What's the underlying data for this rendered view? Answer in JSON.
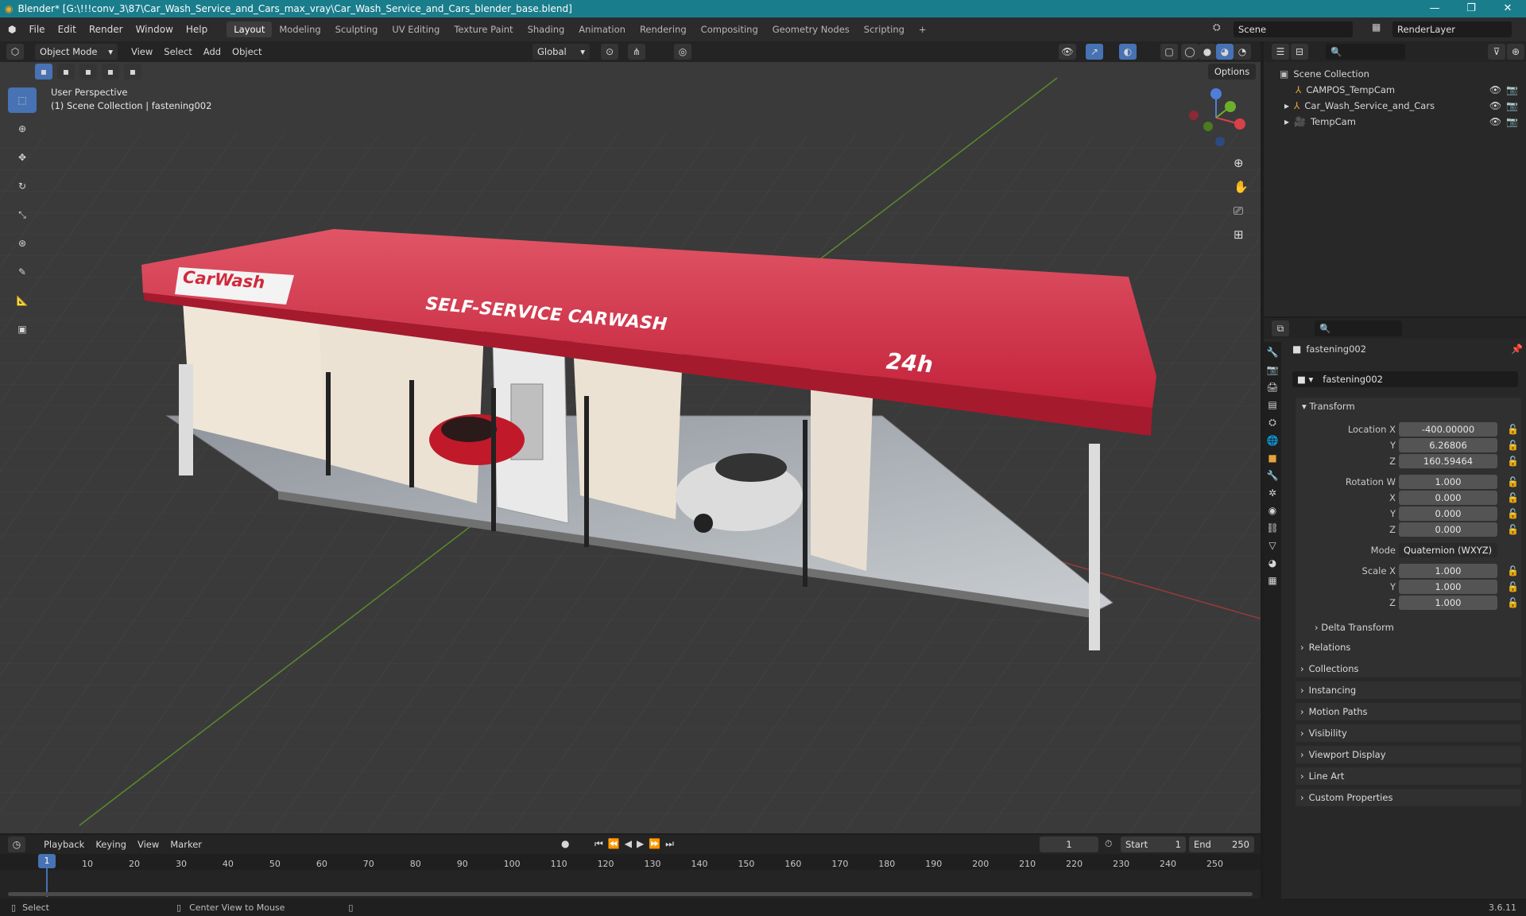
{
  "titlebar": {
    "title": "Blender* [G:\\!!!conv_3\\87\\Car_Wash_Service_and_Cars_max_vray\\Car_Wash_Service_and_Cars_blender_base.blend]"
  },
  "menu": {
    "file": "File",
    "edit": "Edit",
    "render": "Render",
    "window": "Window",
    "help": "Help"
  },
  "workspaces": [
    "Layout",
    "Modeling",
    "Sculpting",
    "UV Editing",
    "Texture Paint",
    "Shading",
    "Animation",
    "Rendering",
    "Compositing",
    "Geometry Nodes",
    "Scripting"
  ],
  "scene": {
    "name": "Scene",
    "view_layer": "RenderLayer"
  },
  "viewport_header": {
    "mode": "Object Mode",
    "view": "View",
    "select": "Select",
    "add": "Add",
    "object": "Object",
    "orientation": "Global",
    "options": "Options"
  },
  "viewport": {
    "perspective": "User Perspective",
    "context": "(1) Scene Collection | fastening002"
  },
  "scene_sign": {
    "logo": "CarWash",
    "banner": "SELF-SERVICE CARWASH",
    "hours": "24h"
  },
  "outliner": {
    "root": "Scene Collection",
    "items": [
      {
        "name": "CAMPOS_TempCam"
      },
      {
        "name": "Car_Wash_Service_and_Cars"
      },
      {
        "name": "TempCam"
      }
    ]
  },
  "properties": {
    "object_name": "fastening002",
    "data_name": "fastening002",
    "transform_header": "Transform",
    "location": {
      "label": "Location X",
      "x": "-400.00000",
      "y": "6.26806",
      "z": "160.59464"
    },
    "rotation": {
      "label": "Rotation W",
      "w": "1.000",
      "x": "0.000",
      "y": "0.000",
      "z": "0.000"
    },
    "mode": {
      "label": "Mode",
      "value": "Quaternion (WXYZ)"
    },
    "scale": {
      "label": "Scale X",
      "x": "1.000",
      "y": "1.000",
      "z": "1.000"
    },
    "axis": {
      "y": "Y",
      "z": "Z",
      "x": "X"
    },
    "delta": "Delta Transform",
    "panels": [
      "Relations",
      "Collections",
      "Instancing",
      "Motion Paths",
      "Visibility",
      "Viewport Display",
      "Line Art",
      "Custom Properties"
    ]
  },
  "timeline": {
    "playback": "Playback",
    "keying": "Keying",
    "view": "View",
    "marker": "Marker",
    "current_frame": "1",
    "start_label": "Start",
    "start": "1",
    "end_label": "End",
    "end": "250",
    "ticks": [
      "1",
      "10",
      "20",
      "30",
      "40",
      "50",
      "60",
      "70",
      "80",
      "90",
      "100",
      "110",
      "120",
      "130",
      "140",
      "150",
      "160",
      "170",
      "180",
      "190",
      "200",
      "210",
      "220",
      "230",
      "240",
      "250"
    ]
  },
  "statusbar": {
    "select": "Select",
    "center": "Center View to Mouse",
    "version": "3.6.11"
  },
  "colors": {
    "accent": "#4772b3",
    "titlebar": "#1a7d8c",
    "canopy": "#d8344a"
  }
}
